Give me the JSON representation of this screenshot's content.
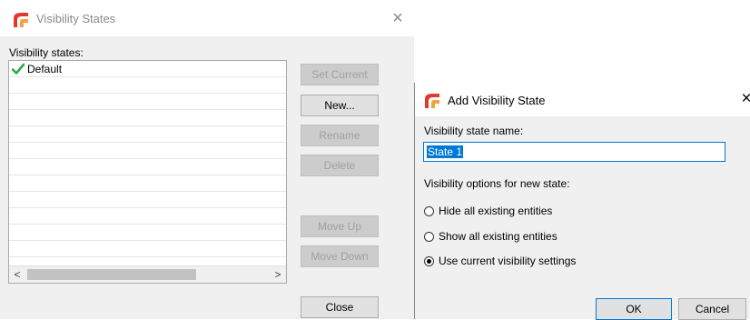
{
  "visibility_states_dialog": {
    "title": "Visibility States",
    "close_glyph": "×",
    "list_label": "Visibility states:",
    "items": [
      {
        "label": "Default",
        "icon": "green-check-icon",
        "current": true
      }
    ],
    "scroll_left_glyph": "<",
    "scroll_right_glyph": ">",
    "buttons": {
      "set_current": "Set Current",
      "new": "New...",
      "rename": "Rename",
      "delete": "Delete",
      "move_up": "Move Up",
      "move_down": "Move Down",
      "close": "Close"
    }
  },
  "add_visibility_state_dialog": {
    "title": "Add Visibility State",
    "close_glyph": "×",
    "name_label": "Visibility state name:",
    "name_value": "State 1",
    "options_label": "Visibility options for new state:",
    "options": [
      {
        "label": "Hide all existing entities",
        "checked": false
      },
      {
        "label": "Show all existing entities",
        "checked": false
      },
      {
        "label": "Use current visibility settings",
        "checked": true
      }
    ],
    "ok_label": "OK",
    "cancel_label": "Cancel"
  },
  "colors": {
    "accent": "#0078d7",
    "check": "#2fa84f",
    "logo_red": "#e03a2f",
    "logo_orange": "#f2a23a"
  }
}
